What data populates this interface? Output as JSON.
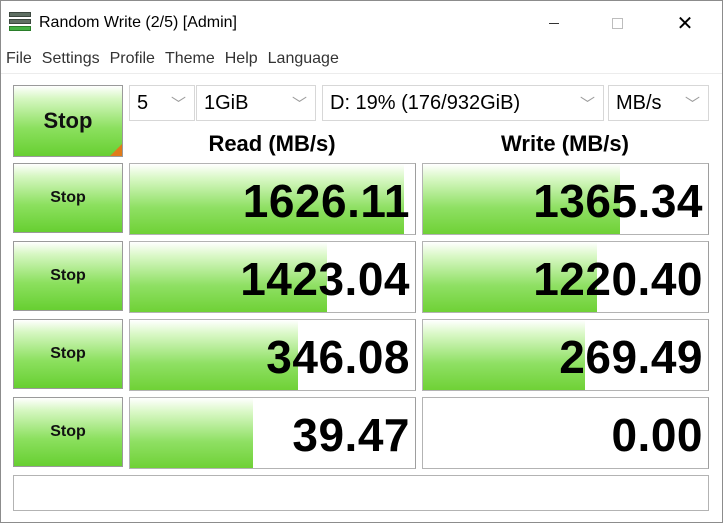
{
  "window": {
    "title": "Random Write (2/5) [Admin]",
    "minimize_glyph": "",
    "maximize_glyph": "",
    "close_glyph": "✕"
  },
  "menu": [
    "File",
    "Settings",
    "Profile",
    "Theme",
    "Help",
    "Language"
  ],
  "controls": {
    "main_stop_label": "Stop",
    "test_count": "5",
    "test_size": "1GiB",
    "drive": "D: 19% (176/932GiB)",
    "unit": "MB/s"
  },
  "headers": {
    "read": "Read (MB/s)",
    "write": "Write (MB/s)"
  },
  "rows": [
    {
      "stop_label": "Stop",
      "read": "1626.11",
      "write": "1365.34",
      "read_fill": 0.96,
      "write_fill": 0.69
    },
    {
      "stop_label": "Stop",
      "read": "1423.04",
      "write": "1220.40",
      "read_fill": 0.69,
      "write_fill": 0.61
    },
    {
      "stop_label": "Stop",
      "read": "346.08",
      "write": "269.49",
      "read_fill": 0.59,
      "write_fill": 0.57
    },
    {
      "stop_label": "Stop",
      "read": "39.47",
      "write": "0.00",
      "read_fill": 0.43,
      "write_fill": 0.0
    }
  ],
  "status_text": "",
  "colors": {
    "accent_green": "#6fd136",
    "corner_orange": "#e07b1a"
  }
}
